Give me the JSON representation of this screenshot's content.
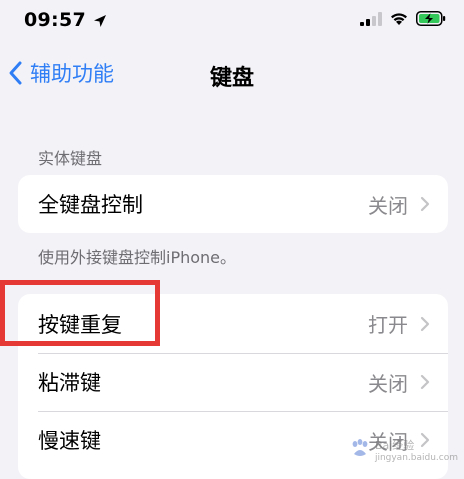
{
  "status_bar": {
    "time": "09:57",
    "icons": [
      "location-arrow-icon",
      "cellular-signal-icon",
      "wifi-icon",
      "battery-charging-icon"
    ]
  },
  "nav": {
    "back_label": "辅助功能",
    "title": "键盘"
  },
  "sections": {
    "physical_keyboard_header": "实体键盘",
    "full_keyboard_control": {
      "label": "全键盘控制",
      "value": "关闭"
    },
    "full_keyboard_footer": "使用外接键盘控制iPhone。",
    "key_settings": [
      {
        "label": "按键重复",
        "value": "打开"
      },
      {
        "label": "粘滞键",
        "value": "关闭"
      },
      {
        "label": "慢速键",
        "value": "关闭"
      }
    ]
  },
  "watermark": {
    "text": "Bai经验",
    "url": "jingyan.baidu.com"
  },
  "colors": {
    "accent": "#2f7ef6",
    "highlight": "#e53935",
    "battery": "#34c759",
    "background": "#f2f2f7"
  }
}
